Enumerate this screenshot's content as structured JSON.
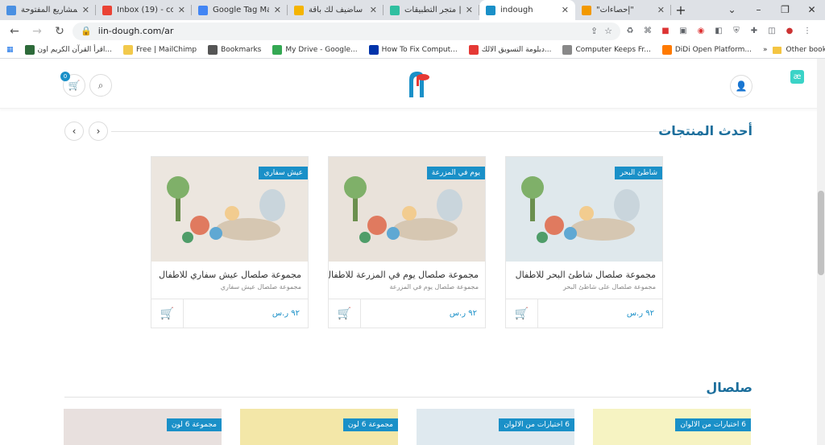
{
  "browser": {
    "tabs": [
      {
        "title": "المشاريع المفتوحة",
        "color": "#4a90e2",
        "active": false
      },
      {
        "title": "Inbox (19) - copie",
        "color": "#ea4335",
        "active": false
      },
      {
        "title": "Google Tag Mana",
        "color": "#4285f4",
        "active": false
      },
      {
        "title": "سأضيف لك باقة",
        "color": "#f4b400",
        "active": false
      },
      {
        "title": "متجر التطبيقات |",
        "color": "#2fbfa0",
        "active": false
      },
      {
        "title": "indough",
        "color": "#1a90c8",
        "active": true
      },
      {
        "title": "\"إحصاءات\"",
        "color": "#f29900",
        "active": false
      }
    ],
    "new_tab": "+",
    "url": "iin-dough.com/ar",
    "bookmarks": [
      {
        "label": "اقرأ القرآن الكريم اون...",
        "color": "#2d6a3a"
      },
      {
        "label": "Free | MailChimp",
        "color": "#f2c94c"
      },
      {
        "label": "Bookmarks",
        "color": "#555555"
      },
      {
        "label": "My Drive - Google...",
        "color": "#34a853"
      },
      {
        "label": "How To Fix Comput...",
        "color": "#0033aa"
      },
      {
        "label": "دبلومة التسويق الالك...",
        "color": "#e53935"
      },
      {
        "label": "Computer Keeps Fr...",
        "color": "#888888"
      },
      {
        "label": "DiDi Open Platform...",
        "color": "#ff7a00"
      }
    ],
    "more": "»",
    "other_bookmarks": "Other bookmarks"
  },
  "site": {
    "cart_count": "0",
    "ae_label": "æ"
  },
  "latest": {
    "title": "أحدث المنتجات",
    "products": [
      {
        "tag": "شاطئ البحر",
        "name": "مجموعة صلصال شاطئ البحر للاطفال",
        "desc": "مجموعة صلصال على شاطئ البحر",
        "price": "٩٢ ر.س",
        "bg": "#dfe8ec"
      },
      {
        "tag": "يوم في المزرعة",
        "name": "مجموعة صلصال يوم في المزرعة للاطفال",
        "desc": "مجموعة صلصال يوم في المزرعة",
        "price": "٩٢ ر.س",
        "bg": "#e9e2da"
      },
      {
        "tag": "عيش سفاري",
        "name": "مجموعة صلصال عيش سفاري للاطفال",
        "desc": "مجموعة صلصال عيش سفاري",
        "price": "٩٢ ر.س",
        "bg": "#ece6df"
      }
    ]
  },
  "clay": {
    "title": "صلصال",
    "cards": [
      {
        "tag": "6 اختيارات من الالوان",
        "bg": "#f6f3c2"
      },
      {
        "tag": "6 اختيارات من الالوان",
        "bg": "#dfe9ef"
      },
      {
        "tag": "مجموعة 6 لون",
        "bg": "#f3e7a8"
      },
      {
        "tag": "مجموعة 6 لون",
        "bg": "#e8e0de"
      }
    ]
  }
}
